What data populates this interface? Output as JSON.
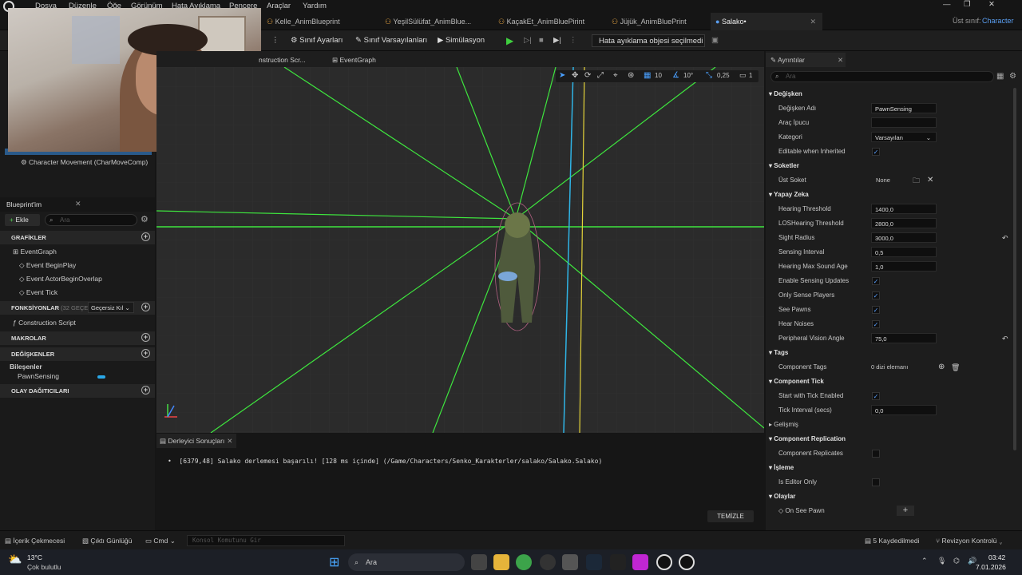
{
  "menu": [
    "Dosya",
    "Düzenle",
    "Öğe",
    "Görünüm",
    "Hata Ayıklama",
    "Pencere",
    "Araçlar",
    "Yardım"
  ],
  "tabs": [
    {
      "label": "Kelle_AnimBlueprint"
    },
    {
      "label": "YeşilSülüfat_AnimBlue..."
    },
    {
      "label": "KaçakEt_AnimBluePirint"
    },
    {
      "label": "Jüjük_AnimBluePrint"
    },
    {
      "label": "Salako•"
    }
  ],
  "parent_class": {
    "label": "Üst sınıf:",
    "value": "Character"
  },
  "toolbar": {
    "class_settings": "Sınıf Ayarları",
    "class_defaults": "Sınıf Varsayılanları",
    "simulation": "Simülasyon",
    "debug_object": "Hata ayıklama objesi seçilmedi"
  },
  "viewport_tabs": {
    "construction": "nstruction Scr...",
    "eventgraph": "EventGraph"
  },
  "viewport_toolbar": {
    "grid": "10",
    "angle": "10°",
    "scale": "0,25",
    "camera": "1"
  },
  "components": {
    "char_movement": "Character Movement (CharMoveComp)"
  },
  "myblueprint": {
    "title": "Blueprint'im",
    "add": "Ekle",
    "search_placeholder": "Ara",
    "graphs_header": "GRAFİKLER",
    "eventgraph": "EventGraph",
    "events": [
      "Event BeginPlay",
      "Event ActorBeginOverlap",
      "Event Tick"
    ],
    "functions_header": "FONKSİYONLAR",
    "functions_note": "(32 GEÇERS",
    "override": "Geçersiz Kıl",
    "construction": "Construction Script",
    "macros_header": "MAKROLAR",
    "variables_header": "DEĞİŞKENLER",
    "components_group": "Bileşenler",
    "pawnsensing": "PawnSensing",
    "dispatchers_header": "OLAY DAĞITICILARI"
  },
  "log": {
    "tab": "Derleyici Sonuçları",
    "message": "[6379,48] Salako derlemesi başarılı! [128 ms içinde] (/Game/Characters/Senko_Karakterler/salako/Salako.Salako)",
    "clear": "TEMİZLE"
  },
  "details": {
    "title": "Ayrıntılar",
    "search_placeholder": "Ara",
    "sections": {
      "variable": "Değişken",
      "sockets": "Soketler",
      "ai": "Yapay Zeka",
      "tags": "Tags",
      "tick": "Component Tick",
      "advanced": "Gelişmiş",
      "replication": "Component Replication",
      "processing": "İşleme",
      "events": "Olaylar"
    },
    "rows": {
      "var_name": {
        "label": "Değişken Adı",
        "value": "PawnSensing"
      },
      "tooltip": {
        "label": "Araç İpucu",
        "value": ""
      },
      "category": {
        "label": "Kategori",
        "value": "Varsayılan"
      },
      "editable": {
        "label": "Editable when Inherited"
      },
      "parent_socket": {
        "label": "Üst Soket",
        "value": "None"
      },
      "hearing": {
        "label": "Hearing Threshold",
        "value": "1400,0"
      },
      "los": {
        "label": "LOSHearing Threshold",
        "value": "2800,0"
      },
      "sight": {
        "label": "Sight Radius",
        "value": "3000,0"
      },
      "interval": {
        "label": "Sensing Interval",
        "value": "0,5"
      },
      "soundage": {
        "label": "Hearing Max Sound Age",
        "value": "1,0"
      },
      "enable": {
        "label": "Enable Sensing Updates"
      },
      "onlyplayers": {
        "label": "Only Sense Players"
      },
      "seepawns": {
        "label": "See Pawns"
      },
      "hearnoises": {
        "label": "Hear Noises"
      },
      "angle": {
        "label": "Peripheral Vision Angle",
        "value": "75,0"
      },
      "comptags": {
        "label": "Component Tags",
        "value": "0 dizi elemanı"
      },
      "starttick": {
        "label": "Start with Tick Enabled"
      },
      "tickinterval": {
        "label": "Tick Interval (secs)",
        "value": "0,0"
      },
      "replicates": {
        "label": "Component Replicates"
      },
      "editoronly": {
        "label": "Is Editor Only"
      },
      "onseepawn": {
        "label": "On See Pawn"
      }
    }
  },
  "statusbar": {
    "content_drawer": "İçerik Çekmecesi",
    "output_log": "Çıktı Günlüğü",
    "cmd": "Cmd",
    "console_placeholder": "Konsol Komutunu Gir",
    "saved": "5 Kaydedilmedi",
    "revision": "Revizyon Kontrolü"
  },
  "taskbar": {
    "temp": "13°C",
    "weather": "Çok bulutlu",
    "search": "Ara",
    "time": "03:42",
    "date": "7.01.2026"
  },
  "colors": {
    "accent": "#2a78d6",
    "green": "#2fd12f",
    "check": "#5aa0ff"
  }
}
